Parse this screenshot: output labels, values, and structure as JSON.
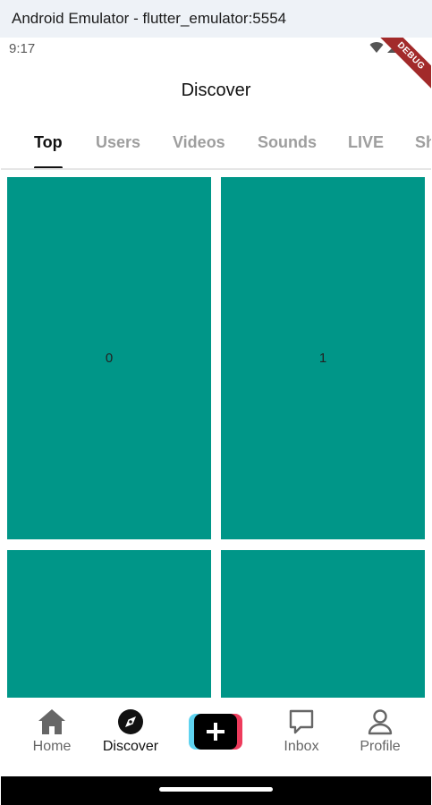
{
  "window": {
    "title": "Android Emulator - flutter_emulator:5554"
  },
  "status": {
    "time": "9:17",
    "debug_label": "DEBUG"
  },
  "appbar": {
    "title": "Discover"
  },
  "tabs": [
    "Top",
    "Users",
    "Videos",
    "Sounds",
    "LIVE",
    "Sh"
  ],
  "active_tab": "Top",
  "grid": {
    "tiles": [
      "0",
      "1",
      "",
      ""
    ],
    "tile_color": "#009688"
  },
  "bottom_nav": {
    "items": [
      {
        "label": "Home",
        "icon": "home-icon"
      },
      {
        "label": "Discover",
        "icon": "compass-icon"
      },
      {
        "label": "",
        "icon": "add-icon"
      },
      {
        "label": "Inbox",
        "icon": "inbox-icon"
      },
      {
        "label": "Profile",
        "icon": "profile-icon"
      }
    ],
    "active": "Discover"
  },
  "colors": {
    "accent_cyan": "#5fd3f0",
    "accent_red": "#ee3b5c",
    "tile": "#009688"
  }
}
